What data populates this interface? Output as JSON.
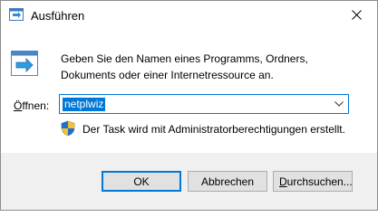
{
  "window": {
    "title": "Ausführen"
  },
  "dialog": {
    "description": "Geben Sie den Namen eines Programms, Ordners, Dokuments oder einer Internetressource an.",
    "open_label_pre": "",
    "open_label_accel": "Ö",
    "open_label_post": "ffnen:",
    "open_value": "netplwiz",
    "admin_note": "Der Task wird mit Administratorberechtigungen erstellt."
  },
  "buttons": {
    "ok": "OK",
    "cancel": "Abbrechen",
    "browse_accel": "D",
    "browse_rest": "urchsuchen..."
  },
  "icons": {
    "title": "run-icon",
    "body": "run-icon",
    "admin": "uac-shield-icon",
    "close": "close-icon",
    "dropdown": "chevron-down-icon"
  },
  "colors": {
    "accent": "#0078d7",
    "footer_bg": "#f0f0f0"
  }
}
